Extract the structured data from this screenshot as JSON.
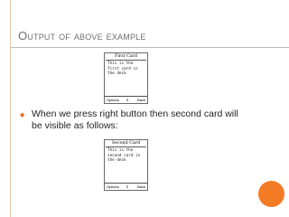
{
  "slide": {
    "title": "Output of above example",
    "bullet": "When  we press right button then second card will be visible as follows:",
    "bullet_marker": "◆"
  },
  "screens": [
    {
      "title": "First Card",
      "body": "This is the first card in the deck",
      "softkeys": {
        "left": "Options",
        "center": "⇕",
        "right": "Back"
      }
    },
    {
      "title": "Second Card",
      "body": "This is the second card in the deck",
      "softkeys": {
        "left": "Options",
        "center": "⇕",
        "right": "Back"
      }
    }
  ],
  "colors": {
    "accent_orange": "#f47b25",
    "title_gray": "#6f6f6f",
    "left_rule": "#e7c6ab"
  }
}
